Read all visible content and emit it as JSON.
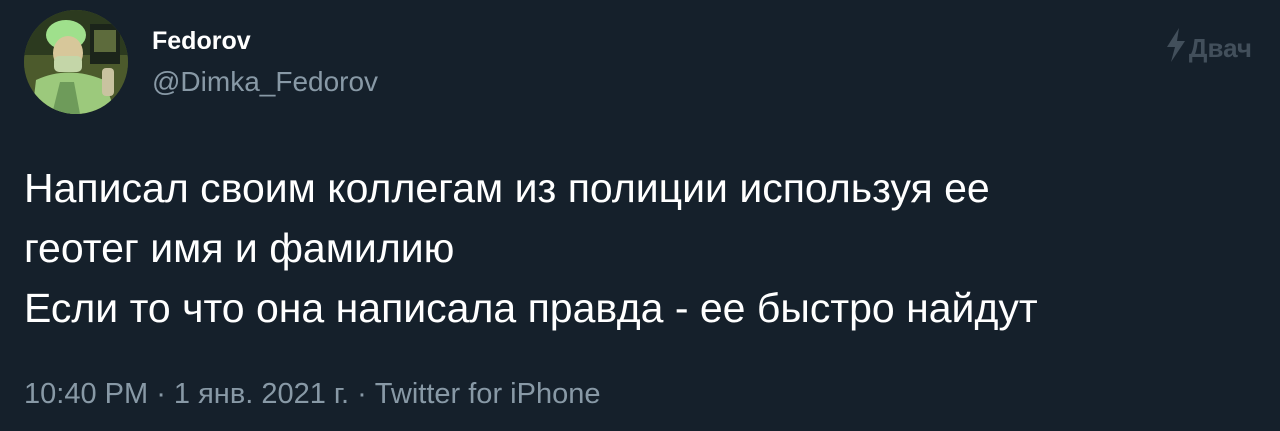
{
  "author": {
    "display_name": "Fedorov",
    "handle": "@Dimka_Fedorov"
  },
  "tweet": {
    "text": "Написал своим коллегам из полиции используя ее\nгеотег имя и фамилию\nЕсли то что она написала правда - ее быстро найдут"
  },
  "meta": {
    "time": "10:40 PM",
    "separator": " · ",
    "date": "1 янв. 2021 г.",
    "source": "Twitter for iPhone"
  },
  "watermark": {
    "text": "Двач",
    "icon": "lightning-bolt-icon"
  },
  "colors": {
    "background": "#15202b",
    "primary_text": "#ffffff",
    "secondary_text": "#8899a6",
    "watermark": "#45525e"
  }
}
